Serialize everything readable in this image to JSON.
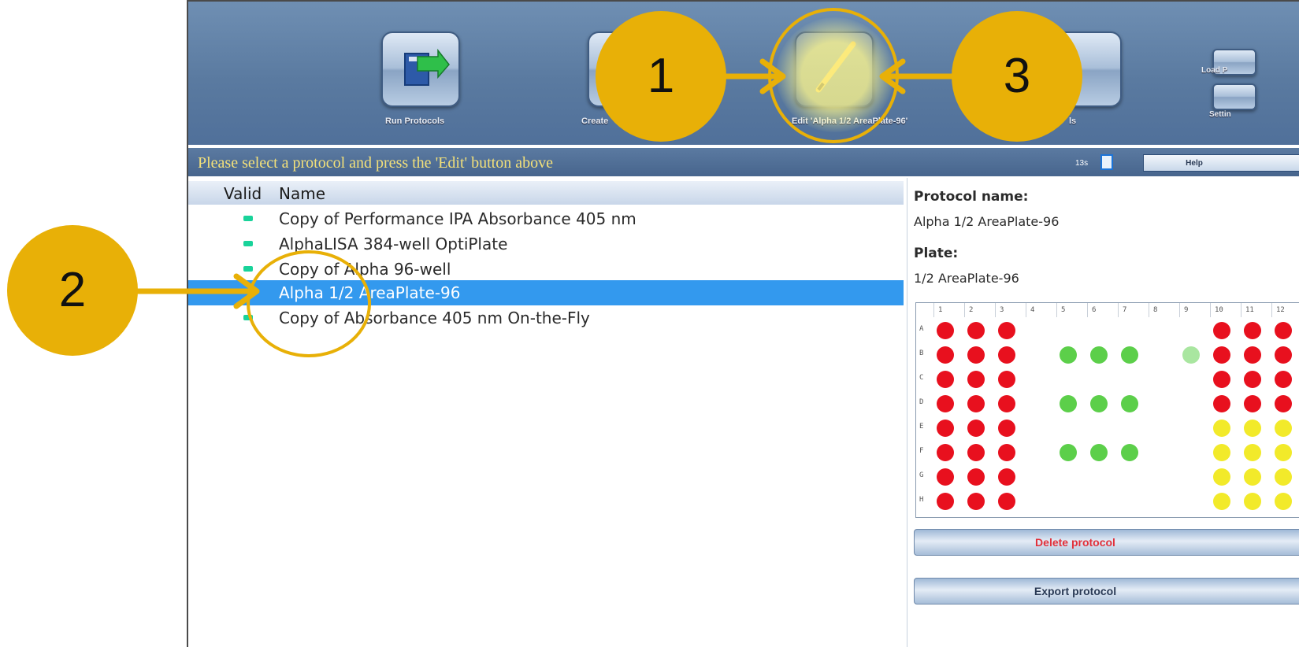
{
  "toolbar": {
    "buttons": [
      {
        "label": "Run Protocols",
        "icon": "run-protocols-icon"
      },
      {
        "label": "Create",
        "icon": "create-protocol-icon"
      },
      {
        "label": "Edit 'Alpha 1/2 AreaPlate-96'",
        "icon": "pencil-icon"
      },
      {
        "label": "ls",
        "icon": "tools-icon"
      },
      {
        "label": "Load P",
        "icon": "load-protocol-icon"
      },
      {
        "label": "Settin",
        "icon": "settings-icon"
      }
    ]
  },
  "status": {
    "message": "Please select a protocol and press the 'Edit' button above",
    "count": "13s",
    "help_label": "Help"
  },
  "list": {
    "col_valid": "Valid",
    "col_name": "Name",
    "rows": [
      {
        "name": "Copy of Performance IPA Absorbance 405 nm",
        "selected": false
      },
      {
        "name": "AlphaLISA 384-well OptiPlate",
        "selected": false
      },
      {
        "name": "Copy of Alpha 96-well",
        "selected": false
      },
      {
        "name": "Alpha 1/2 AreaPlate-96",
        "selected": true
      },
      {
        "name": "Copy of Absorbance 405 nm On-the-Fly",
        "selected": false
      }
    ]
  },
  "details": {
    "protocol_name_label": "Protocol name:",
    "protocol_name": "Alpha 1/2 AreaPlate-96",
    "plate_label": "Plate:",
    "plate": "1/2 AreaPlate-96",
    "plate_columns": [
      "1",
      "2",
      "3",
      "4",
      "5",
      "6",
      "7",
      "8",
      "9",
      "10",
      "11",
      "12"
    ],
    "plate_rows": [
      "A",
      "B",
      "C",
      "D",
      "E",
      "F",
      "G",
      "H"
    ],
    "well_colors": {
      "red": "#e8101e",
      "green": "#5ccf4a",
      "light_green": "#a9e6a0",
      "yellow": "#f2ea2a"
    },
    "delete_label": "Delete protocol",
    "export_label": "Export protocol"
  },
  "callouts": [
    "1",
    "2",
    "3"
  ]
}
